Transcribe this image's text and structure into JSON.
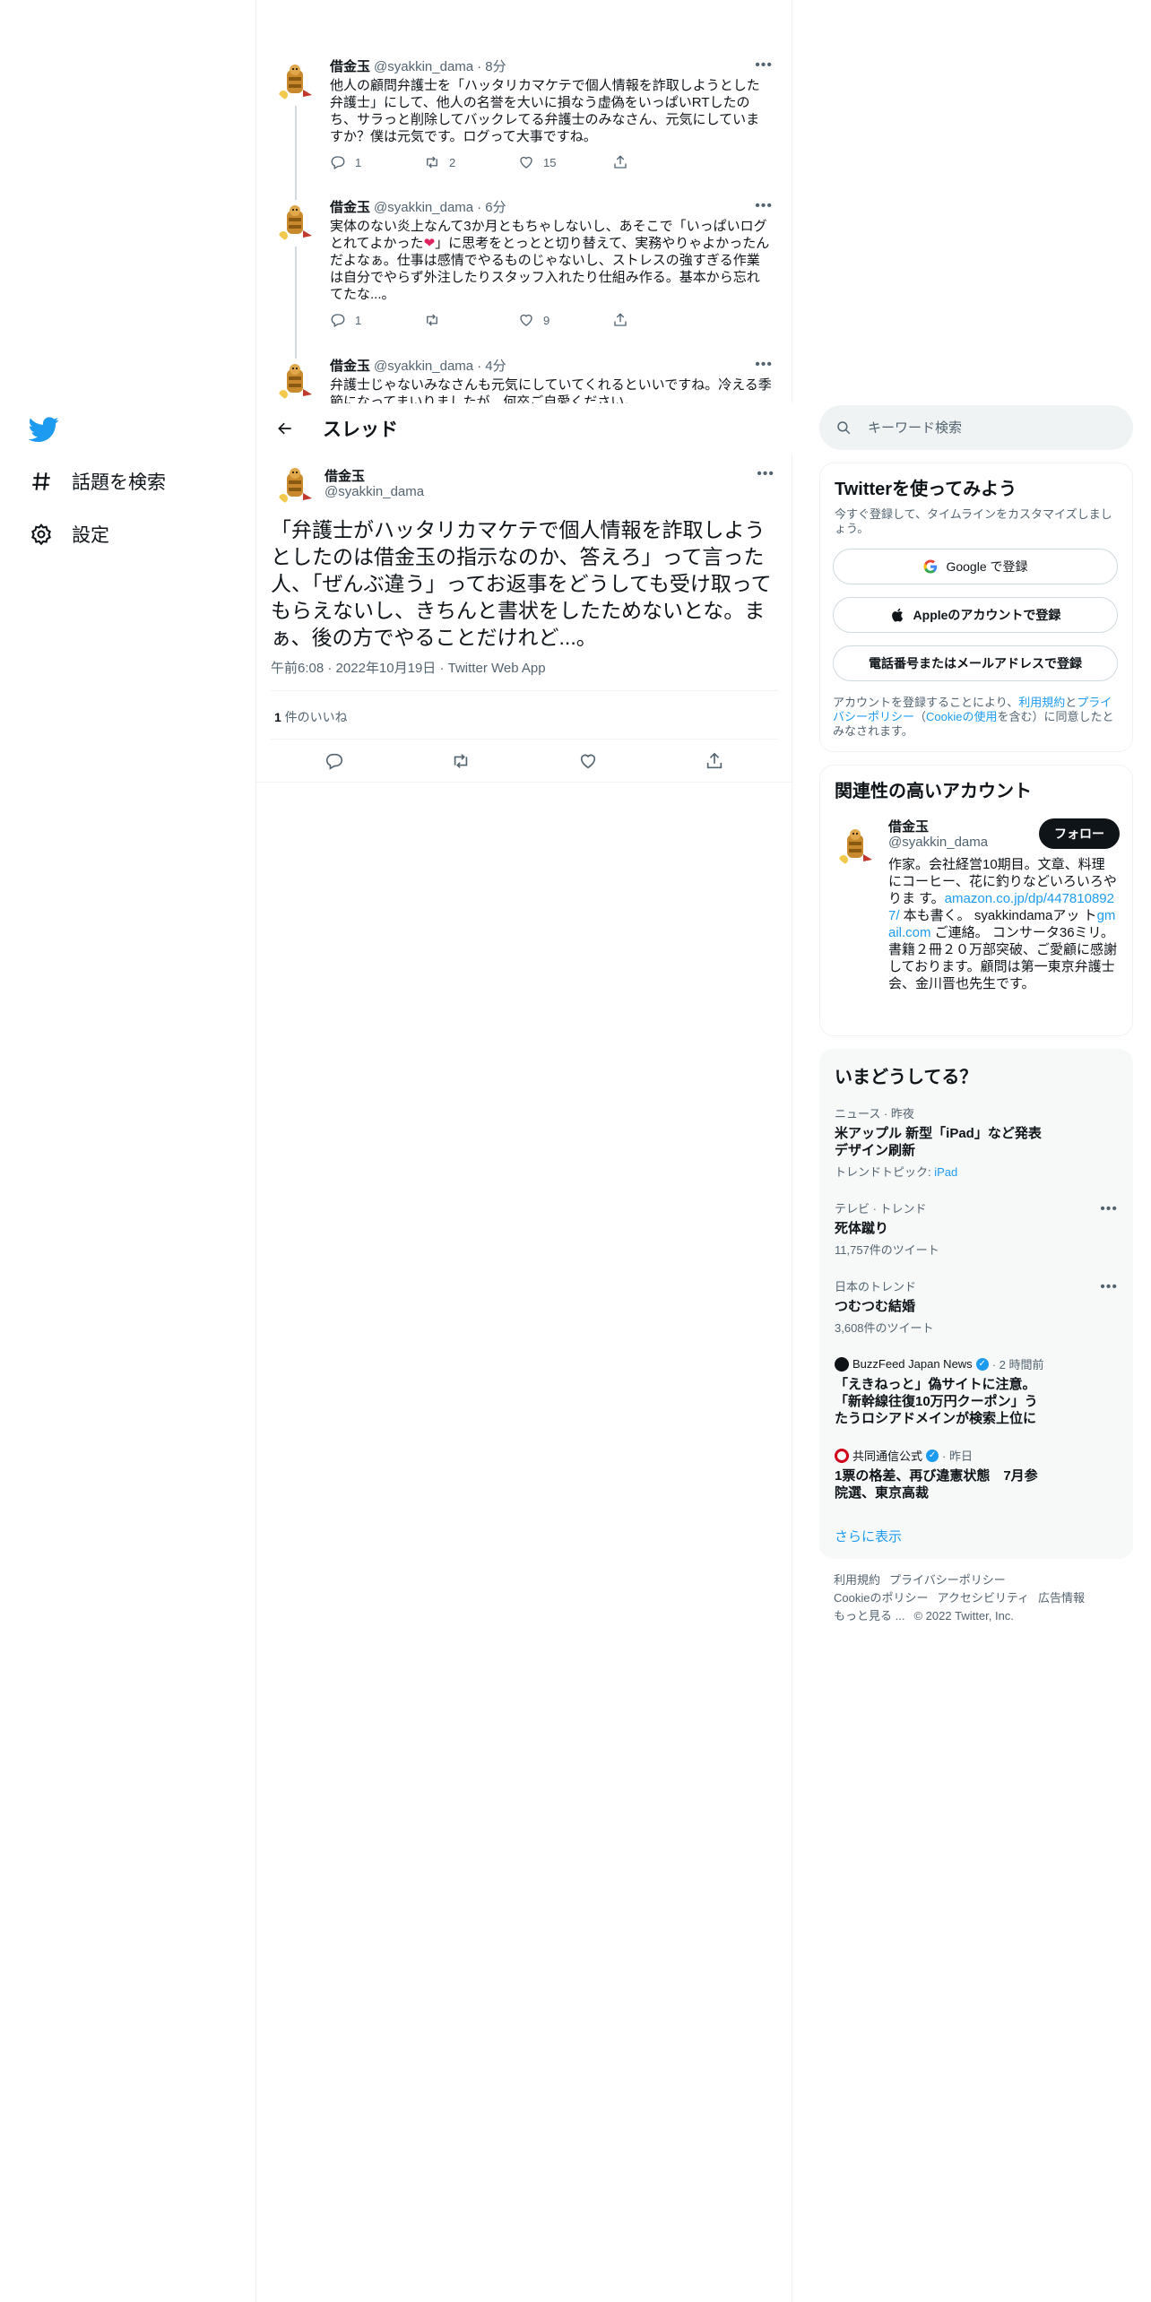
{
  "nav": {
    "items": [
      {
        "label": "話題を検索",
        "icon": "hash-icon"
      },
      {
        "label": "設定",
        "icon": "gear-icon"
      }
    ]
  },
  "thread": {
    "title": "スレッド",
    "tweets": [
      {
        "name": "借金玉",
        "handle": "@syakkin_dama",
        "time": "· 8分",
        "text": "他人の顧問弁護士を「ハッタリカマケテで個人情報を詐取しようとした弁護士」にして、他人の名誉を大いに損なう虚偽をいっぱいRTしたのち、サラっと削除してバックレてる弁護士のみなさん、元気にしていますか？僕は元気です。ログって大事ですね。",
        "reply": "1",
        "retweet": "2",
        "like": "15"
      },
      {
        "name": "借金玉",
        "handle": "@syakkin_dama",
        "time": "· 6分",
        "text_before": "実体のない炎上なんて3か月ともちゃしないし、あそこで「いっぱいログとれてよかった",
        "heart": "❤️",
        "text_after": "」に思考をとっとと切り替えて、実務やりゃよかったんだよなぁ。仕事は感情でやるものじゃないし、ストレスの強すぎる作業は自分でやらず外注したりスタッフ入れたり仕組み作る。基本から忘れてたな...。",
        "reply": "1",
        "retweet": "",
        "like": "9"
      },
      {
        "name": "借金玉",
        "handle": "@syakkin_dama",
        "time": "· 4分",
        "text": "弁護士じゃないみなさんも元気にしていてくれるといいですね。冷える季節になってまいりましたが、何卒ご自愛ください。"
      }
    ],
    "main": {
      "name": "借金玉",
      "handle": "@syakkin_dama",
      "text": "「弁護士がハッタリカマケテで個人情報を詐取しようとしたのは借金玉の指示なのか、答えろ」って言った人、「ぜんぶ違う」ってお返事をどうしても受け取ってもらえないし、きちんと書状をしたためないとな。まぁ、後の方でやることだけれど...。",
      "time": "午前6:08",
      "date": "2022年10月19日",
      "source": "Twitter Web App",
      "sep": "·",
      "likes_count": "1",
      "likes_label": " 件のいいね"
    }
  },
  "search": {
    "placeholder": "キーワード検索"
  },
  "signup": {
    "title": "Twitterを使ってみよう",
    "subtitle": "今すぐ登録して、タイムラインをカスタマイズしましょう。",
    "google": "Google で登録",
    "apple": "Appleのアカウントで登録",
    "phone": "電話番号またはメールアドレスで登録",
    "legal_1": "アカウントを登録することにより、",
    "legal_terms": "利用規約",
    "legal_2": "と",
    "legal_privacy": "プライバシーポリシー",
    "legal_3": "（",
    "legal_cookie": "Cookieの使用",
    "legal_4": "を含む）に同意したとみなされます。"
  },
  "related": {
    "title": "関連性の高いアカウント",
    "name": "借金玉",
    "handle": "@syakkin_dama",
    "follow": "フォロー",
    "bio_1": "作家。会社経営10期目。文章、料理にコーヒー、花に釣りなどいろいろやりま す。",
    "bio_link1": "amazon.co.jp/dp/4478108927/",
    "bio_2": " 本も書く。 syakkindamaアッ ト",
    "bio_link2": "gmail.com",
    "bio_3": " ご連絡。 コンサータ36ミリ。書籍２冊２０万部突破、ご愛顧に感謝しております。顧問は第一東京弁護士会、金川晋也先生です。"
  },
  "trends": {
    "title": "いまどうしてる？",
    "items": [
      {
        "meta": "ニュース · 昨夜",
        "name": "米アップル 新型「iPad」など発表 デザイン刷新",
        "sub_prefix": "トレンドトピック: ",
        "sub_link": "iPad"
      },
      {
        "meta": "テレビ · トレンド",
        "name": "死体蹴り",
        "sub": "11,757件のツイート"
      },
      {
        "meta": "日本のトレンド",
        "name": "つむつむ結婚",
        "sub": "3,608件のツイート"
      },
      {
        "source": "BuzzFeed Japan News",
        "time": "· 2 時間前",
        "name": "「えきねっと」偽サイトに注意。「新幹線往復10万円クーポン」うたうロシアドメインが検索上位に"
      },
      {
        "source": "共同通信公式",
        "time": "· 昨日",
        "name": "1票の格差、再び違憲状態　7月参院選、東京高裁"
      }
    ],
    "show_more": "さらに表示"
  },
  "footer": {
    "links": [
      "利用規約",
      "プライバシーポリシー",
      "Cookieのポリシー",
      "アクセシビリティ",
      "広告情報",
      "もっと見る ..."
    ],
    "copyright": "© 2022 Twitter, Inc."
  },
  "colors": {
    "accent": "#1d9bf0",
    "text": "#0f1419",
    "muted": "#536471"
  }
}
